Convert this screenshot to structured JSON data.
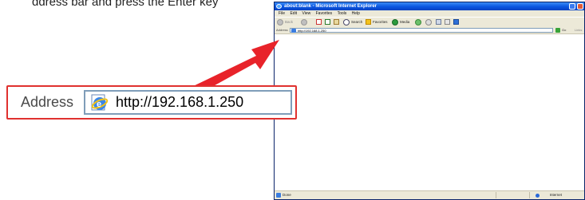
{
  "caption": "ddress bar and press the Enter key",
  "browser": {
    "title": "about:blank - Microsoft Internet Explorer",
    "menu": [
      "File",
      "Edit",
      "View",
      "Favorites",
      "Tools",
      "Help"
    ],
    "toolbar": {
      "back": "Back",
      "search": "Search",
      "favorites": "Favorites",
      "media": "Media"
    },
    "address_label": "Address",
    "url": "http://192.168.1.250",
    "go_label": "Go",
    "links_label": "Links",
    "status_left": "Done",
    "status_right": "Internet"
  },
  "callout": {
    "label": "Address",
    "url": "http://192.168.1.250"
  },
  "colors": {
    "callout_border": "#e0312f",
    "arrow": "#e8232a",
    "xp_titlebar": "#0a55e0"
  }
}
